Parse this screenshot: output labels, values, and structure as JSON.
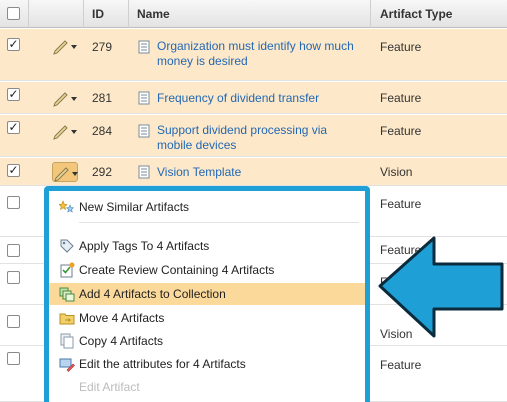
{
  "table": {
    "headers": {
      "id": "ID",
      "name": "Name",
      "artifact_type": "Artifact Type"
    },
    "rows": [
      {
        "checked": true,
        "id": "279",
        "name": "Organization must identify how much money is desired",
        "type": "Feature"
      },
      {
        "checked": true,
        "id": "281",
        "name": "Frequency of dividend transfer",
        "type": "Feature"
      },
      {
        "checked": true,
        "id": "284",
        "name": "Support dividend processing via mobile devices",
        "type": "Feature"
      },
      {
        "checked": true,
        "id": "292",
        "name": "Vision Template",
        "type": "Vision"
      },
      {
        "checked": false,
        "type": "Feature"
      },
      {
        "checked": false,
        "type": "Feature"
      },
      {
        "checked": false,
        "type": "F"
      },
      {
        "checked": false,
        "type": "Vision"
      },
      {
        "checked": false,
        "type": "Feature"
      }
    ],
    "checked_mark": "✓"
  },
  "context_menu": {
    "items": [
      {
        "label": "New Similar Artifacts",
        "icon": "new-similar-icon"
      },
      {
        "label": "Apply Tags To 4 Artifacts",
        "icon": "tag-icon"
      },
      {
        "label": "Create Review Containing 4 Artifacts",
        "icon": "review-icon"
      },
      {
        "label": "Add 4 Artifacts to Collection",
        "icon": "collection-icon",
        "highlighted": true
      },
      {
        "label": "Move 4 Artifacts",
        "icon": "folder-move-icon"
      },
      {
        "label": "Copy 4 Artifacts",
        "icon": "copy-icon"
      },
      {
        "label": "Edit the attributes for 4 Artifacts",
        "icon": "edit-attributes-icon"
      },
      {
        "label": "Edit Artifact",
        "icon": "edit-icon",
        "disabled": true
      }
    ]
  },
  "colors": {
    "selected_row": "#fde9c9",
    "link": "#2368b5",
    "menu_border": "#1e9fd6",
    "menu_highlight": "#fbd99b",
    "arrow_fill": "#1e9fd6"
  }
}
